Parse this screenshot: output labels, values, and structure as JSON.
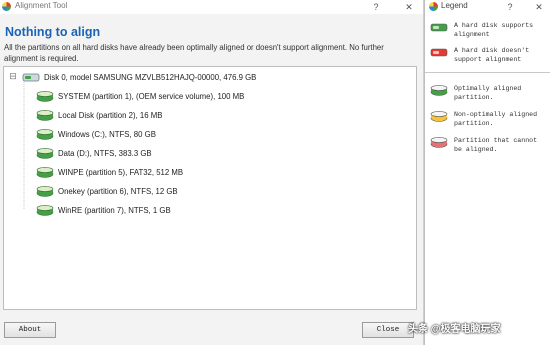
{
  "main_window": {
    "title": "Alignment Tool",
    "help_glyph": "?",
    "close_glyph": "✕",
    "headline": "Nothing to align",
    "description": "All the partitions on all hard disks have already been optimally aligned or doesn't support alignment. No further alignment is required.",
    "disk": {
      "expander": "⊟",
      "label": "Disk 0, model SAMSUNG MZVLB512HAJQ-00000, 476.9 GB",
      "icon": "hard-disk-icon"
    },
    "partitions": [
      {
        "label": "SYSTEM (partition 1),  (OEM service volume), 100 MB",
        "status": "optimal"
      },
      {
        "label": "Local Disk (partition 2), 16 MB",
        "status": "optimal"
      },
      {
        "label": "Windows (C:), NTFS, 80 GB",
        "status": "optimal"
      },
      {
        "label": "Data (D:), NTFS, 383.3 GB",
        "status": "optimal"
      },
      {
        "label": "WINPE (partition 5), FAT32, 512 MB",
        "status": "optimal"
      },
      {
        "label": "Onekey (partition 6), NTFS, 12 GB",
        "status": "optimal"
      },
      {
        "label": "WinRE (partition 7), NTFS, 1 GB",
        "status": "optimal"
      }
    ],
    "buttons": {
      "about": "About",
      "close": "Close"
    }
  },
  "legend": {
    "title": "Legend",
    "help_glyph": "?",
    "close_glyph": "✕",
    "disk_items": [
      {
        "text": "A hard disk supports alignment",
        "color": "#43a047"
      },
      {
        "text": "A hard disk doesn't support alignment",
        "color": "#e53935"
      }
    ],
    "partition_items": [
      {
        "text": "Optimally aligned partition.",
        "color": "#43a047"
      },
      {
        "text": "Non-optimally aligned partition.",
        "color": "#f2c53d"
      },
      {
        "text": "Partition that cannot be aligned.",
        "color": "#e57373"
      }
    ]
  },
  "watermark": "头条 @极客电脑玩家",
  "colors": {
    "headline": "#1a63b8",
    "optimal": "#43a047",
    "non_optimal": "#f2c53d",
    "unsupported": "#e57373"
  }
}
